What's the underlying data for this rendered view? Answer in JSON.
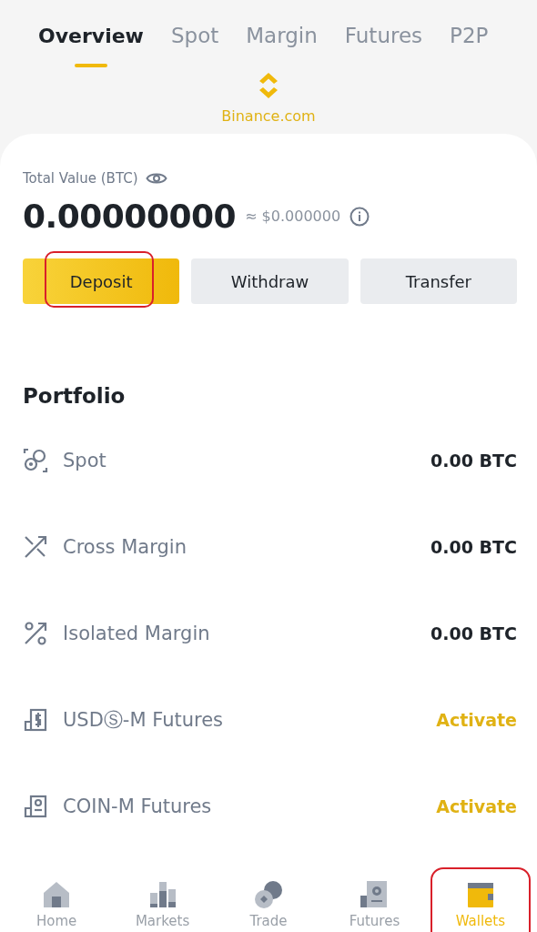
{
  "tabs": [
    {
      "label": "Overview",
      "selected": true
    },
    {
      "label": "Spot",
      "selected": false
    },
    {
      "label": "Margin",
      "selected": false
    },
    {
      "label": "Futures",
      "selected": false
    },
    {
      "label": "P2P",
      "selected": false
    }
  ],
  "account": {
    "label": "Binance.com"
  },
  "total": {
    "label": "Total Value (BTC)",
    "value": "0.00000000",
    "fiat": "≈ $0.000000"
  },
  "actions": [
    {
      "label": "Deposit",
      "kind": "primary",
      "highlighted": true
    },
    {
      "label": "Withdraw",
      "kind": "secondary",
      "highlighted": false
    },
    {
      "label": "Transfer",
      "kind": "secondary",
      "highlighted": false
    }
  ],
  "portfolio": {
    "title": "Portfolio",
    "rows": [
      {
        "name": "Spot",
        "kind": "balance",
        "value": "0.00 BTC"
      },
      {
        "name": "Cross Margin",
        "kind": "balance",
        "value": "0.00 BTC"
      },
      {
        "name": "Isolated Margin",
        "kind": "balance",
        "value": "0.00 BTC"
      },
      {
        "name": "USDⓈ-M Futures",
        "kind": "action",
        "value": "Activate"
      },
      {
        "name": "COIN-M Futures",
        "kind": "action",
        "value": "Activate"
      }
    ]
  },
  "nav": [
    {
      "label": "Home",
      "selected": false,
      "highlighted": false
    },
    {
      "label": "Markets",
      "selected": false,
      "highlighted": false
    },
    {
      "label": "Trade",
      "selected": false,
      "highlighted": false
    },
    {
      "label": "Futures",
      "selected": false,
      "highlighted": false
    },
    {
      "label": "Wallets",
      "selected": true,
      "highlighted": true
    }
  ]
}
